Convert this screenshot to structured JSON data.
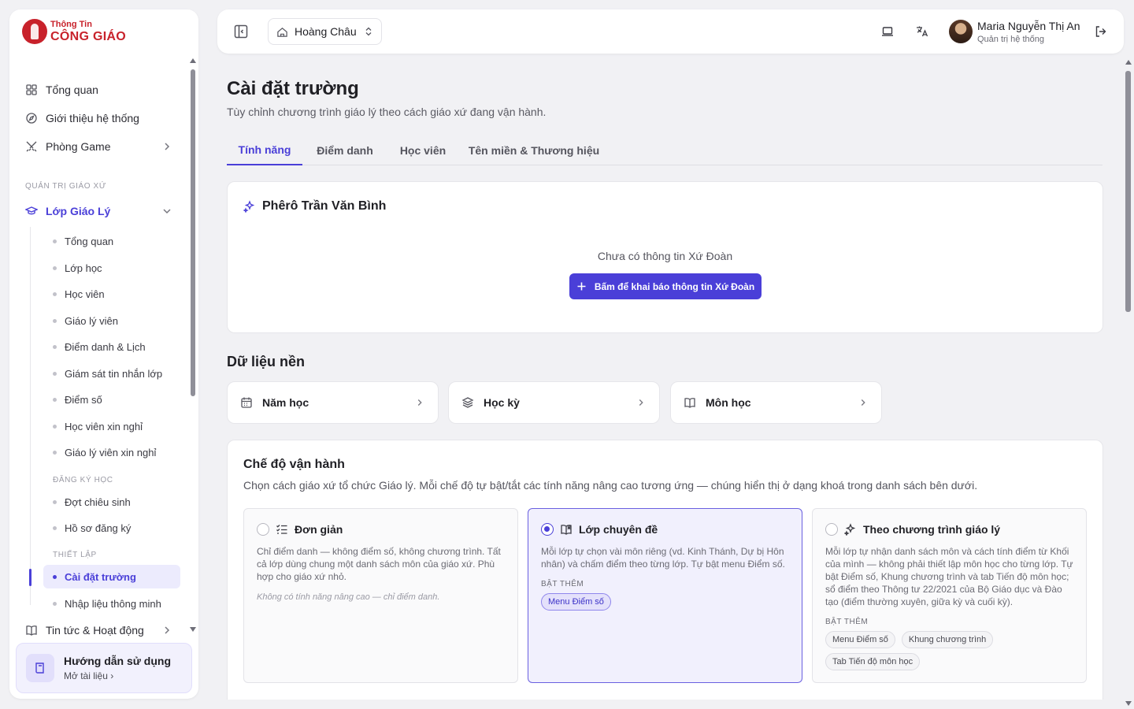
{
  "brand": {
    "line1": "Thông Tin",
    "line2": "CÔNG GIÁO",
    "color": "#c8222b"
  },
  "accent": "#4a3fd8",
  "sidebar": {
    "top_items": [
      {
        "label": "Tổng quan",
        "icon": "grid-icon"
      },
      {
        "label": "Giới thiệu hệ thống",
        "icon": "compass-icon"
      },
      {
        "label": "Phòng Game",
        "icon": "swords-icon"
      }
    ],
    "section_label": "QUẢN TRỊ GIÁO XỨ",
    "group": {
      "label": "Lớp Giáo Lý",
      "icon": "graduation-cap-icon"
    },
    "sub_items": [
      "Tổng quan",
      "Lớp học",
      "Học viên",
      "Giáo lý viên",
      "Điểm danh & Lịch",
      "Giám sát tin nhắn lớp",
      "Điểm số",
      "Học viên xin nghỉ",
      "Giáo lý viên xin nghỉ"
    ],
    "enroll_label": "ĐĂNG KÝ HỌC",
    "enroll_items": [
      "Đợt chiêu sinh",
      "Hồ sơ đăng ký"
    ],
    "setup_label": "THIẾT LẬP",
    "setup_items": [
      "Cài đặt trường",
      "Nhập liệu thông minh"
    ],
    "news": {
      "label": "Tin tức & Hoạt động",
      "icon": "book-open-icon"
    },
    "guide": {
      "title": "Hướng dẫn sử dụng",
      "link": "Mở tài liệu"
    }
  },
  "header": {
    "parish": "Hoàng Châu",
    "user_name": "Maria Nguyễn Thị An",
    "user_role": "Quản trị hệ thống"
  },
  "page": {
    "title": "Cài đặt trường",
    "description": "Tùy chỉnh chương trình giáo lý theo cách giáo xứ đang vận hành.",
    "tabs": [
      "Tính năng",
      "Điểm danh",
      "Học viên",
      "Tên miền & Thương hiệu"
    ]
  },
  "xu_doan": {
    "title": "Phêrô Trần Văn Bình",
    "empty": "Chưa có thông tin Xứ Đoàn",
    "button": "Bấm để khai báo thông tin Xứ Đoàn"
  },
  "base_data": {
    "title": "Dữ liệu nền",
    "items": [
      "Năm học",
      "Học kỳ",
      "Môn học"
    ]
  },
  "mode": {
    "title": "Chế độ vận hành",
    "description": "Chọn cách giáo xứ tổ chức Giáo lý. Mỗi chế độ tự bật/tắt các tính năng nâng cao tương ứng — chúng hiển thị ở dạng khoá trong danh sách bên dưới.",
    "extra_label": "BẬT THÊM",
    "options": [
      {
        "title": "Đơn giản",
        "desc": "Chỉ điểm danh — không điểm số, không chương trình. Tất cả lớp dùng chung một danh sách môn của giáo xứ. Phù hợp cho giáo xứ nhỏ.",
        "note": "Không có tính năng nâng cao — chỉ điểm danh."
      },
      {
        "title": "Lớp chuyên đề",
        "desc": "Mỗi lớp tự chọn vài môn riêng (vd. Kinh Thánh, Dự bị Hôn nhân) và chấm điểm theo từng lớp. Tự bật menu Điểm số.",
        "chips": [
          "Menu Điểm số"
        ]
      },
      {
        "title": "Theo chương trình giáo lý",
        "desc": "Mỗi lớp tự nhận danh sách môn và cách tính điểm từ Khối của mình — không phải thiết lập môn học cho từng lớp. Tự bật Điểm số, Khung chương trình và tab Tiến độ môn học; sổ điểm theo Thông tư 22/2021 của Bộ Giáo dục và Đào tạo (điểm thường xuyên, giữa kỳ và cuối kỳ).",
        "chips": [
          "Menu Điểm số",
          "Khung chương trình",
          "Tab Tiến độ môn học"
        ]
      }
    ]
  }
}
